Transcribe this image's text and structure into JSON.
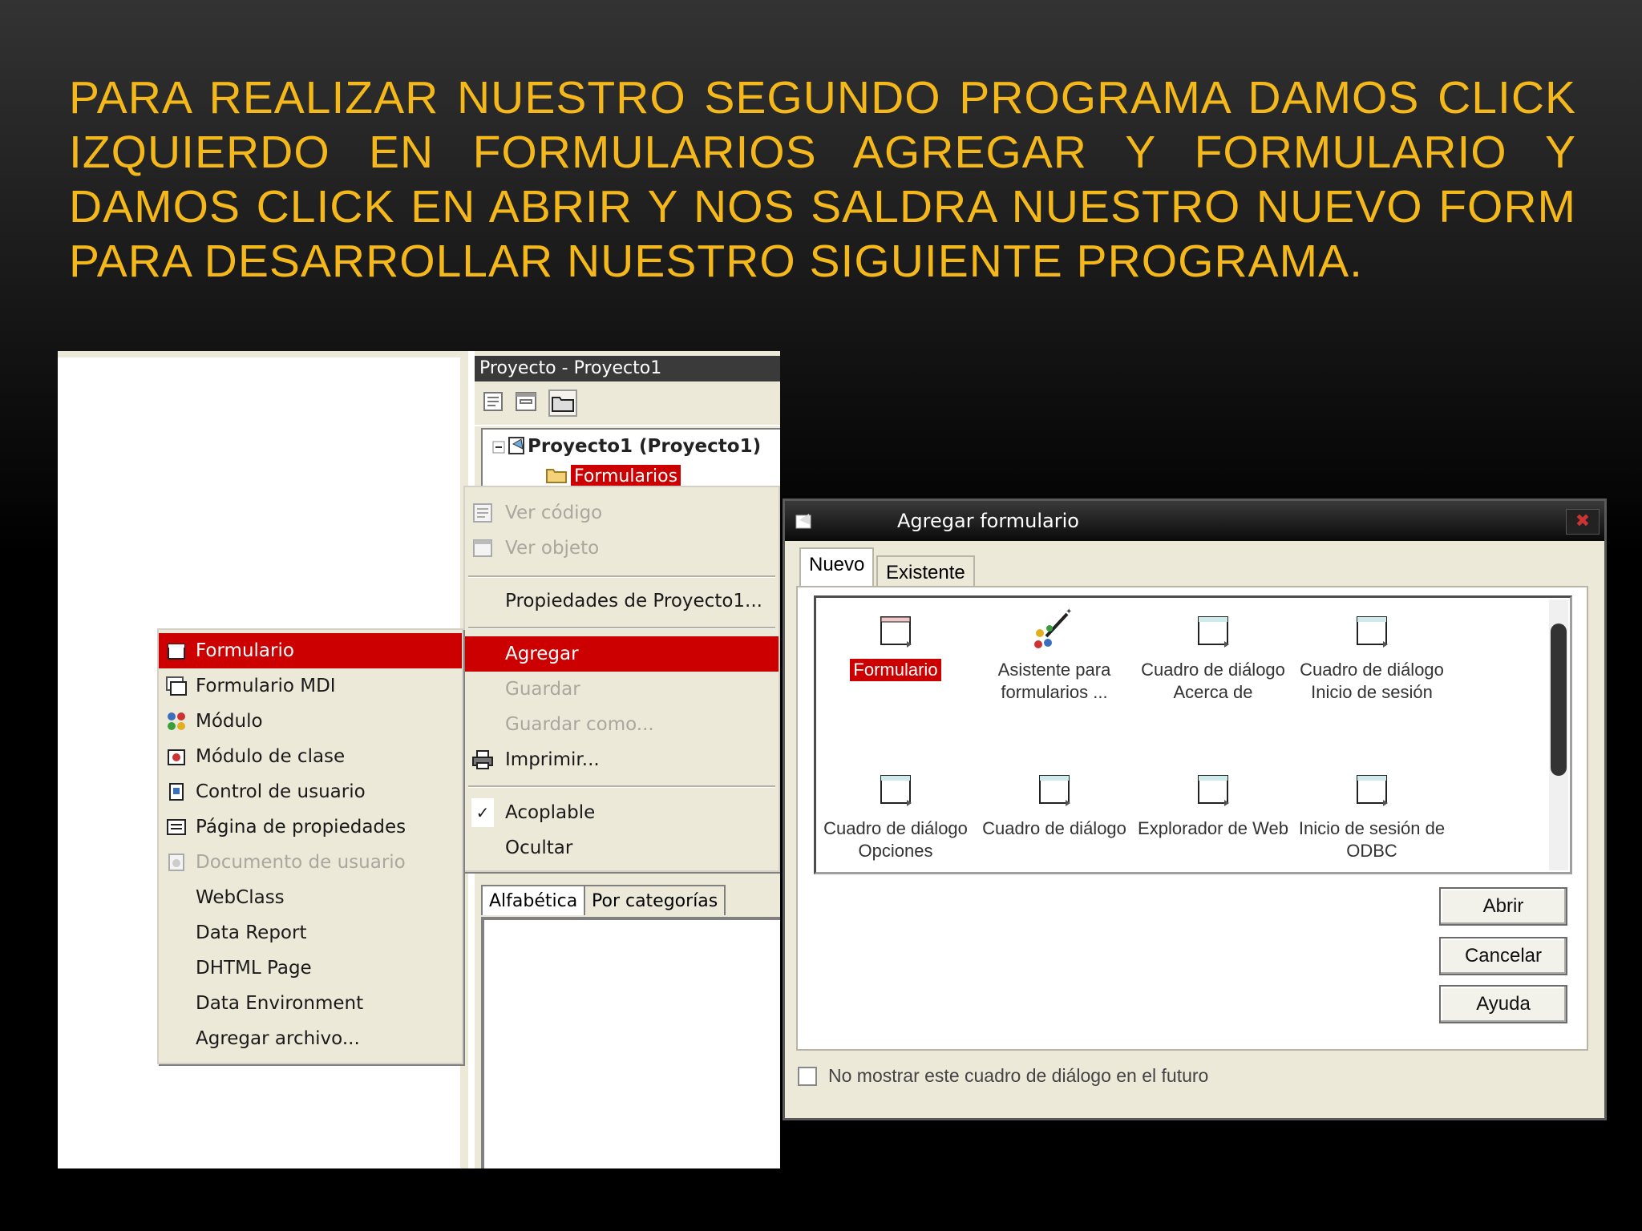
{
  "headline": "PARA REALIZAR NUESTRO SEGUNDO PROGRAMA DAMOS CLICK IZQUIERDO EN FORMULARIOS AGREGAR Y FORMULARIO Y DAMOS CLICK EN ABRIR Y NOS SALDRA NUESTRO NUEVO FORM PARA DESARROLLAR NUESTRO SIGUIENTE PROGRAMA.",
  "project_panel": {
    "title": "Proyecto - Proyecto1",
    "tree_root": "Proyecto1 (Proyecto1)",
    "tree_selected": "Formularios"
  },
  "context_menu": {
    "items": [
      {
        "label": "Ver código",
        "state": "disabled"
      },
      {
        "label": "Ver objeto",
        "state": "disabled"
      },
      {
        "label": "Propiedades de Proyecto1...",
        "state": "normal"
      },
      {
        "label": "Agregar",
        "state": "highlighted"
      },
      {
        "label": "Guardar",
        "state": "disabled"
      },
      {
        "label": "Guardar como...",
        "state": "disabled"
      },
      {
        "label": "Imprimir...",
        "state": "normal"
      },
      {
        "label": "Acoplable",
        "state": "checked"
      },
      {
        "label": "Ocultar",
        "state": "normal"
      }
    ]
  },
  "submenu": {
    "items": [
      {
        "label": "Formulario",
        "state": "highlighted"
      },
      {
        "label": "Formulario MDI",
        "state": "normal"
      },
      {
        "label": "Módulo",
        "state": "normal"
      },
      {
        "label": "Módulo de clase",
        "state": "normal"
      },
      {
        "label": "Control de usuario",
        "state": "normal"
      },
      {
        "label": "Página de propiedades",
        "state": "normal"
      },
      {
        "label": "Documento de usuario",
        "state": "disabled"
      },
      {
        "label": "WebClass",
        "state": "normal"
      },
      {
        "label": "Data Report",
        "state": "normal"
      },
      {
        "label": "DHTML Page",
        "state": "normal"
      },
      {
        "label": "Data Environment",
        "state": "normal"
      },
      {
        "label": "Agregar archivo...",
        "state": "normal"
      }
    ]
  },
  "properties_tabs": [
    "Alfabética",
    "Por categorías"
  ],
  "dialog": {
    "title": "Agregar formulario",
    "tabs": [
      "Nuevo",
      "Existente"
    ],
    "icons": [
      {
        "label": "Formulario",
        "selected": true
      },
      {
        "label": "Asistente para formularios ...",
        "selected": false
      },
      {
        "label": "Cuadro de diálogo Acerca de",
        "selected": false
      },
      {
        "label": "Cuadro de diálogo Inicio de sesión",
        "selected": false
      },
      {
        "label": "Cuadro de diálogo Opciones",
        "selected": false
      },
      {
        "label": "Cuadro de diálogo",
        "selected": false
      },
      {
        "label": "Explorador de Web",
        "selected": false
      },
      {
        "label": "Inicio de sesión de ODBC",
        "selected": false
      }
    ],
    "buttons": {
      "open": "Abrir",
      "cancel": "Cancelar",
      "help": "Ayuda"
    },
    "checkbox_label": "No mostrar este cuadro de diálogo en el futuro"
  },
  "colors": {
    "headline": "#f5b81b",
    "highlight": "#cc0000",
    "panel": "#ece9d8"
  }
}
